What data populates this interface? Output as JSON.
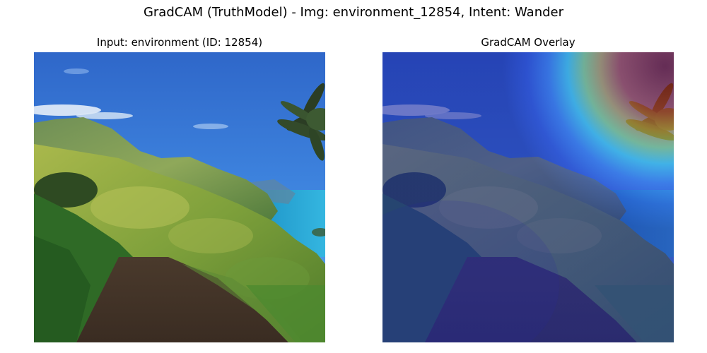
{
  "figure": {
    "suptitle": "GradCAM (TruthModel) - Img: environment_12854, Intent: Wander"
  },
  "panels": [
    {
      "title": "Input: environment (ID: 12854)"
    },
    {
      "title": "GradCAM Overlay"
    }
  ]
}
